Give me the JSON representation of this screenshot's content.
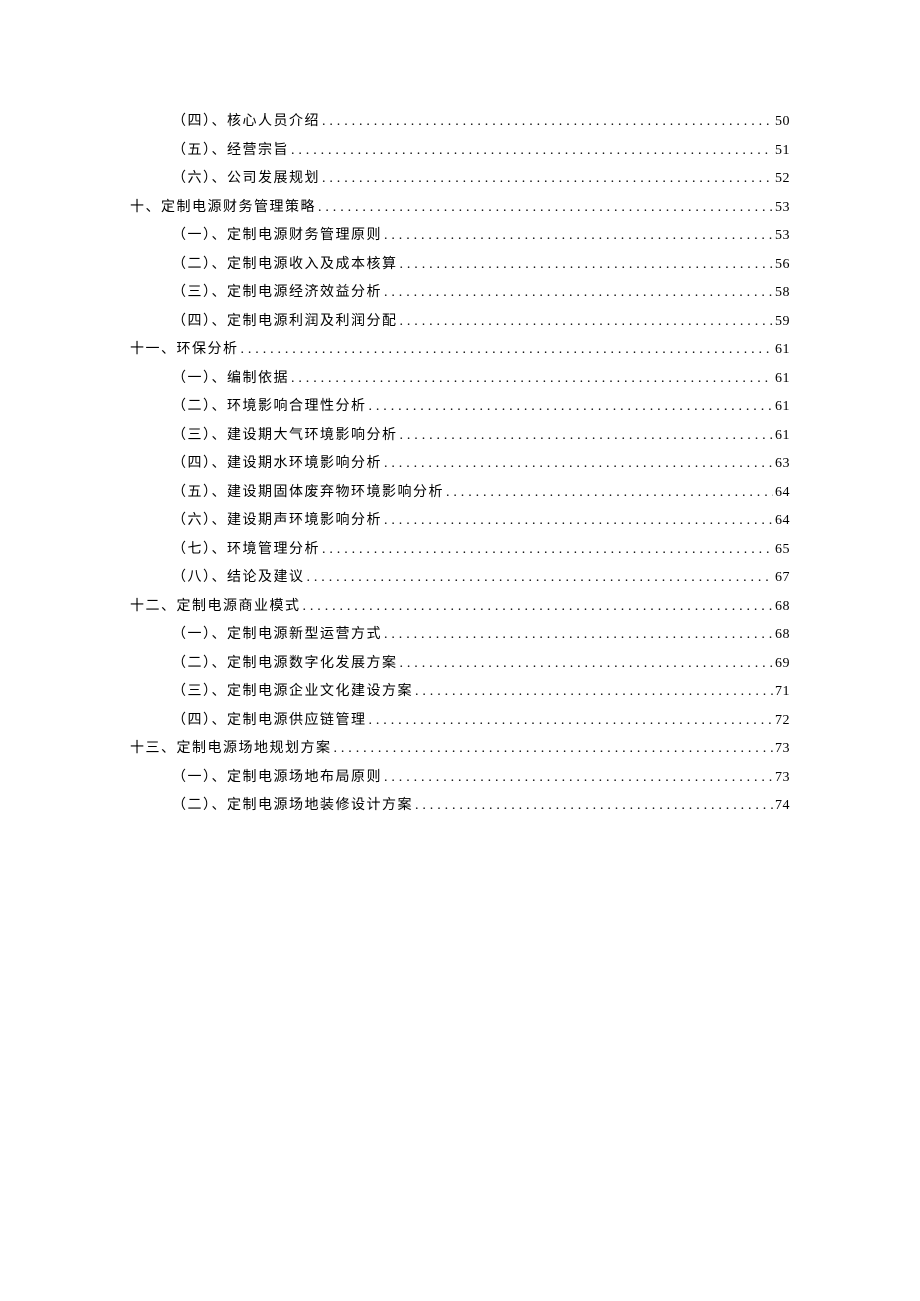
{
  "toc": [
    {
      "level": 2,
      "label": "（四）、核心人员介绍",
      "page": "50"
    },
    {
      "level": 2,
      "label": "（五）、经营宗旨",
      "page": "51"
    },
    {
      "level": 2,
      "label": "（六）、公司发展规划",
      "page": "52"
    },
    {
      "level": 1,
      "label": "十、定制电源财务管理策略",
      "page": "53"
    },
    {
      "level": 2,
      "label": "（一）、定制电源财务管理原则",
      "page": "53"
    },
    {
      "level": 2,
      "label": "（二）、定制电源收入及成本核算",
      "page": "56"
    },
    {
      "level": 2,
      "label": "（三）、定制电源经济效益分析",
      "page": "58"
    },
    {
      "level": 2,
      "label": "（四）、定制电源利润及利润分配",
      "page": "59"
    },
    {
      "level": 1,
      "label": "十一、环保分析",
      "page": "61"
    },
    {
      "level": 2,
      "label": "（一）、编制依据",
      "page": "61"
    },
    {
      "level": 2,
      "label": "（二）、环境影响合理性分析",
      "page": "61"
    },
    {
      "level": 2,
      "label": "（三）、建设期大气环境影响分析",
      "page": "61"
    },
    {
      "level": 2,
      "label": "（四）、建设期水环境影响分析",
      "page": "63"
    },
    {
      "level": 2,
      "label": "（五）、建设期固体废弃物环境影响分析",
      "page": "64"
    },
    {
      "level": 2,
      "label": "（六）、建设期声环境影响分析",
      "page": "64"
    },
    {
      "level": 2,
      "label": "（七）、环境管理分析",
      "page": "65"
    },
    {
      "level": 2,
      "label": "（八）、结论及建议",
      "page": "67"
    },
    {
      "level": 1,
      "label": "十二、定制电源商业模式",
      "page": "68"
    },
    {
      "level": 2,
      "label": "（一）、定制电源新型运营方式",
      "page": "68"
    },
    {
      "level": 2,
      "label": "（二）、定制电源数字化发展方案",
      "page": "69"
    },
    {
      "level": 2,
      "label": "（三）、定制电源企业文化建设方案",
      "page": "71"
    },
    {
      "level": 2,
      "label": "（四）、定制电源供应链管理",
      "page": "72"
    },
    {
      "level": 1,
      "label": "十三、定制电源场地规划方案",
      "page": "73"
    },
    {
      "level": 2,
      "label": "（一）、定制电源场地布局原则",
      "page": "73"
    },
    {
      "level": 2,
      "label": "（二）、定制电源场地装修设计方案",
      "page": "74"
    }
  ]
}
